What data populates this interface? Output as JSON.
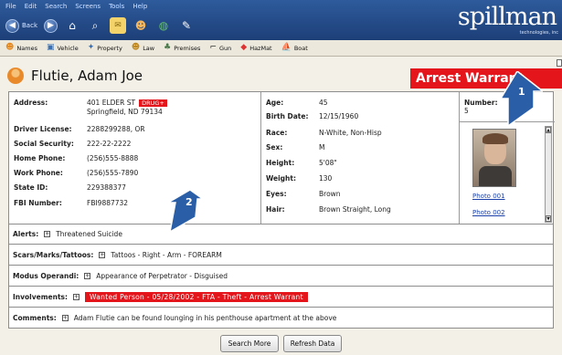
{
  "menu": [
    "File",
    "Edit",
    "Search",
    "Screens",
    "Tools",
    "Help"
  ],
  "nav": {
    "back_label": "Back"
  },
  "brand": {
    "name": "spillman",
    "subtitle": "technologies, inc"
  },
  "search_types": [
    {
      "label": "Names",
      "icon": "person-icon"
    },
    {
      "label": "Vehicle",
      "icon": "car-icon"
    },
    {
      "label": "Property",
      "icon": "property-icon"
    },
    {
      "label": "Law",
      "icon": "law-icon"
    },
    {
      "label": "Premises",
      "icon": "premises-icon"
    },
    {
      "label": "Gun",
      "icon": "gun-icon"
    },
    {
      "label": "HazMat",
      "icon": "hazmat-icon"
    },
    {
      "label": "Boat",
      "icon": "boat-icon"
    }
  ],
  "person": {
    "name": "Flutie, Adam Joe",
    "banner": "Arrest Warrant"
  },
  "info": {
    "address_label": "Address:",
    "address_line1": "401 ELDER ST",
    "address_flag": "DRUG+",
    "address_line2": "Springfield, ND 79134",
    "license_label": "Driver License:",
    "license_value": "2288299288, OR",
    "ssn_label": "Social Security:",
    "ssn_value": "222-22-2222",
    "home_label": "Home Phone:",
    "home_value": "(256)555-8888",
    "work_label": "Work Phone:",
    "work_value": "(256)555-7890",
    "state_label": "State ID:",
    "state_value": "229388377",
    "fbi_label": "FBI Number:",
    "fbi_value": "FBI9887732",
    "age_label": "Age:",
    "age_value": "45",
    "dob_label": "Birth Date:",
    "dob_value": "12/15/1960",
    "race_label": "Race:",
    "race_value": "N-White, Non-Hisp",
    "sex_label": "Sex:",
    "sex_value": "M",
    "height_label": "Height:",
    "height_value": "5'08\"",
    "weight_label": "Weight:",
    "weight_value": "130",
    "eyes_label": "Eyes:",
    "eyes_value": "Brown",
    "hair_label": "Hair:",
    "hair_value": "Brown Straight, Long",
    "number_label": "Number:",
    "number_value": "5",
    "photo1": "Photo 001",
    "photo2": "Photo 002"
  },
  "rows": {
    "alerts_label": "Alerts:",
    "alerts_value": "Threatened Suicide",
    "scars_label": "Scars/Marks/Tattoos:",
    "scars_value": "Tattoos - Right - Arm - FOREARM",
    "mo_label": "Modus Operandi:",
    "mo_value": "Appearance of Perpetrator - Disguised",
    "inv_label": "Involvements:",
    "inv_value": "Wanted Person  -  05/28/2002  -  FTA - Theft  -  Arrest Warrant",
    "comments_label": "Comments:",
    "comments_value": "Adam Flutie can be found lounging in his penthouse apartment at the above"
  },
  "buttons": {
    "search_more": "Search More",
    "refresh": "Refresh Data"
  },
  "callouts": {
    "one": "1",
    "two": "2"
  },
  "colors": {
    "topbar": "#1d3f78",
    "alert_red": "#e4161c",
    "callout_blue": "#2a5fa8"
  }
}
